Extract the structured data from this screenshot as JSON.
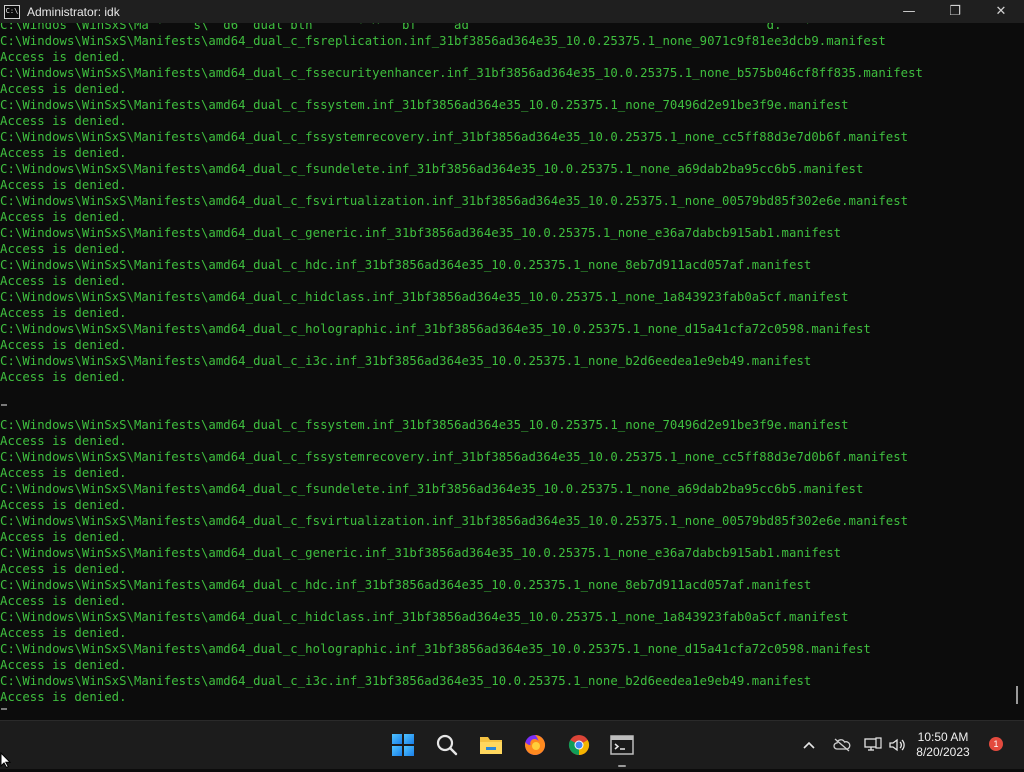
{
  "window": {
    "title": "Administrator: idk",
    "app_icon_label": "C:\\",
    "minimize_label": "—",
    "maximize_label": "❐",
    "close_label": "✕"
  },
  "console": {
    "text_color": "#3fbf3f",
    "lines": [
      "C:\\Windos \\WinSxS\\Ma '    s\\  d6  dual bth      ' ^   bf     ad                                        d.   '",
      "C:\\Windows\\WinSxS\\Manifests\\amd64_dual_c_fsreplication.inf_31bf3856ad364e35_10.0.25375.1_none_9071c9f81ee3dcb9.manifest",
      "Access is denied.",
      "C:\\Windows\\WinSxS\\Manifests\\amd64_dual_c_fssecurityenhancer.inf_31bf3856ad364e35_10.0.25375.1_none_b575b046cf8ff835.manifest",
      "Access is denied.",
      "C:\\Windows\\WinSxS\\Manifests\\amd64_dual_c_fssystem.inf_31bf3856ad364e35_10.0.25375.1_none_70496d2e91be3f9e.manifest",
      "Access is denied.",
      "C:\\Windows\\WinSxS\\Manifests\\amd64_dual_c_fssystemrecovery.inf_31bf3856ad364e35_10.0.25375.1_none_cc5ff88d3e7d0b6f.manifest",
      "Access is denied.",
      "C:\\Windows\\WinSxS\\Manifests\\amd64_dual_c_fsundelete.inf_31bf3856ad364e35_10.0.25375.1_none_a69dab2ba95cc6b5.manifest",
      "Access is denied.",
      "C:\\Windows\\WinSxS\\Manifests\\amd64_dual_c_fsvirtualization.inf_31bf3856ad364e35_10.0.25375.1_none_00579bd85f302e6e.manifest",
      "Access is denied.",
      "C:\\Windows\\WinSxS\\Manifests\\amd64_dual_c_generic.inf_31bf3856ad364e35_10.0.25375.1_none_e36a7dabcb915ab1.manifest",
      "Access is denied.",
      "C:\\Windows\\WinSxS\\Manifests\\amd64_dual_c_hdc.inf_31bf3856ad364e35_10.0.25375.1_none_8eb7d911acd057af.manifest",
      "Access is denied.",
      "C:\\Windows\\WinSxS\\Manifests\\amd64_dual_c_hidclass.inf_31bf3856ad364e35_10.0.25375.1_none_1a843923fab0a5cf.manifest",
      "Access is denied.",
      "C:\\Windows\\WinSxS\\Manifests\\amd64_dual_c_holographic.inf_31bf3856ad364e35_10.0.25375.1_none_d15a41cfa72c0598.manifest",
      "Access is denied.",
      "C:\\Windows\\WinSxS\\Manifests\\amd64_dual_c_i3c.inf_31bf3856ad364e35_10.0.25375.1_none_b2d6eedea1e9eb49.manifest",
      "Access is denied.",
      "",
      "",
      "C:\\Windows\\WinSxS\\Manifests\\amd64_dual_c_fssystem.inf_31bf3856ad364e35_10.0.25375.1_none_70496d2e91be3f9e.manifest",
      "Access is denied.",
      "C:\\Windows\\WinSxS\\Manifests\\amd64_dual_c_fssystemrecovery.inf_31bf3856ad364e35_10.0.25375.1_none_cc5ff88d3e7d0b6f.manifest",
      "Access is denied.",
      "C:\\Windows\\WinSxS\\Manifests\\amd64_dual_c_fsundelete.inf_31bf3856ad364e35_10.0.25375.1_none_a69dab2ba95cc6b5.manifest",
      "Access is denied.",
      "C:\\Windows\\WinSxS\\Manifests\\amd64_dual_c_fsvirtualization.inf_31bf3856ad364e35_10.0.25375.1_none_00579bd85f302e6e.manifest",
      "Access is denied.",
      "C:\\Windows\\WinSxS\\Manifests\\amd64_dual_c_generic.inf_31bf3856ad364e35_10.0.25375.1_none_e36a7dabcb915ab1.manifest",
      "Access is denied.",
      "C:\\Windows\\WinSxS\\Manifests\\amd64_dual_c_hdc.inf_31bf3856ad364e35_10.0.25375.1_none_8eb7d911acd057af.manifest",
      "Access is denied.",
      "C:\\Windows\\WinSxS\\Manifests\\amd64_dual_c_hidclass.inf_31bf3856ad364e35_10.0.25375.1_none_1a843923fab0a5cf.manifest",
      "Access is denied.",
      "C:\\Windows\\WinSxS\\Manifests\\amd64_dual_c_holographic.inf_31bf3856ad364e35_10.0.25375.1_none_d15a41cfa72c0598.manifest",
      "Access is denied.",
      "C:\\Windows\\WinSxS\\Manifests\\amd64_dual_c_i3c.inf_31bf3856ad364e35_10.0.25375.1_none_b2d6eedea1e9eb49.manifest",
      "Access is denied."
    ]
  },
  "taskbar": {
    "icons": [
      "start-icon",
      "search-icon",
      "file-explorer-icon",
      "firefox-icon",
      "chrome-icon",
      "terminal-icon"
    ],
    "tray_icons": [
      "chevron-up-icon",
      "onedrive-icon",
      "network-icon",
      "volume-icon"
    ],
    "time": "10:50 AM",
    "date": "8/20/2023",
    "notification_count": "1",
    "notification_color": "#e34a3e"
  }
}
